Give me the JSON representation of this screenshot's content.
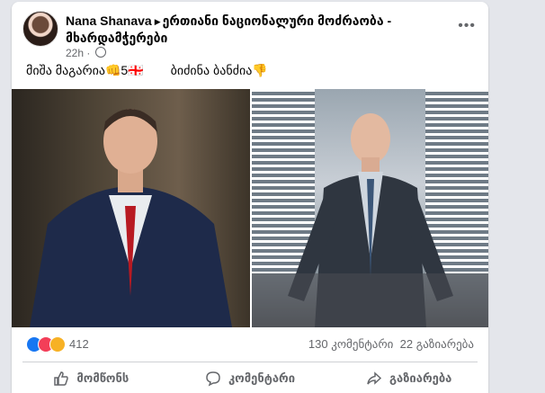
{
  "post": {
    "author": "Nana Shanava",
    "group": "ერთიანი ნაციონალური მოძრაობა - მხარდამჭერები",
    "time": "22h",
    "text_left": "მიშა მაგარია👊5🇬🇪",
    "text_right": "ბიძინა ბანძია👎"
  },
  "stats": {
    "reaction_count": "412",
    "comments": "130 კომენტარი",
    "shares": "22 გაზიარება"
  },
  "actions": {
    "like": "მომწონს",
    "comment": "კომენტარი",
    "share": "გაზიარება"
  },
  "icons": [
    "more-options-icon",
    "globe-icon",
    "like-reaction-icon",
    "love-reaction-icon",
    "wow-reaction-icon",
    "thumbs-up-icon",
    "comment-icon",
    "share-icon"
  ],
  "colors": {
    "like_blue": "#1877f2",
    "love_red": "#f33e58",
    "wow_yellow": "#f7b125",
    "secondary_text": "#65676b"
  }
}
